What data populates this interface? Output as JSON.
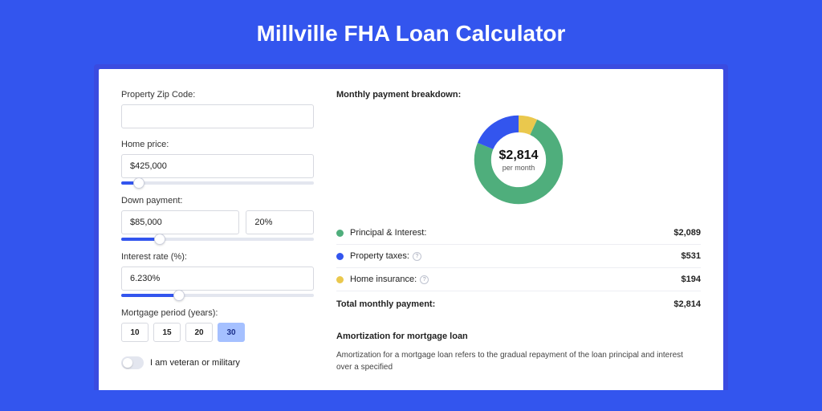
{
  "title": "Millville FHA Loan Calculator",
  "form": {
    "zip_label": "Property Zip Code:",
    "zip_value": "",
    "home_price_label": "Home price:",
    "home_price_value": "$425,000",
    "home_price_slider_pct": 9,
    "down_payment_label": "Down payment:",
    "down_payment_value": "$85,000",
    "down_payment_pct_value": "20%",
    "down_payment_slider_pct": 20,
    "interest_label": "Interest rate (%):",
    "interest_value": "6.230%",
    "interest_slider_pct": 30,
    "period_label": "Mortgage period (years):",
    "periods": [
      "10",
      "15",
      "20",
      "30"
    ],
    "period_active_index": 3,
    "veteran_label": "I am veteran or military"
  },
  "breakdown": {
    "title": "Monthly payment breakdown:",
    "center_amount": "$2,814",
    "center_sub": "per month",
    "items": [
      {
        "label": "Principal & Interest:",
        "value": "$2,089",
        "color": "#4fae7c",
        "info": false
      },
      {
        "label": "Property taxes:",
        "value": "$531",
        "color": "#3355ee",
        "info": true
      },
      {
        "label": "Home insurance:",
        "value": "$194",
        "color": "#eac84d",
        "info": true
      }
    ],
    "total_label": "Total monthly payment:",
    "total_value": "$2,814"
  },
  "amortization": {
    "title": "Amortization for mortgage loan",
    "text": "Amortization for a mortgage loan refers to the gradual repayment of the loan principal and interest over a specified"
  },
  "chart_data": {
    "type": "pie",
    "title": "Monthly payment breakdown",
    "series": [
      {
        "name": "Principal & Interest",
        "value": 2089,
        "color": "#4fae7c"
      },
      {
        "name": "Property taxes",
        "value": 531,
        "color": "#3355ee"
      },
      {
        "name": "Home insurance",
        "value": 194,
        "color": "#eac84d"
      }
    ],
    "total": 2814,
    "center_label": "$2,814 per month"
  }
}
